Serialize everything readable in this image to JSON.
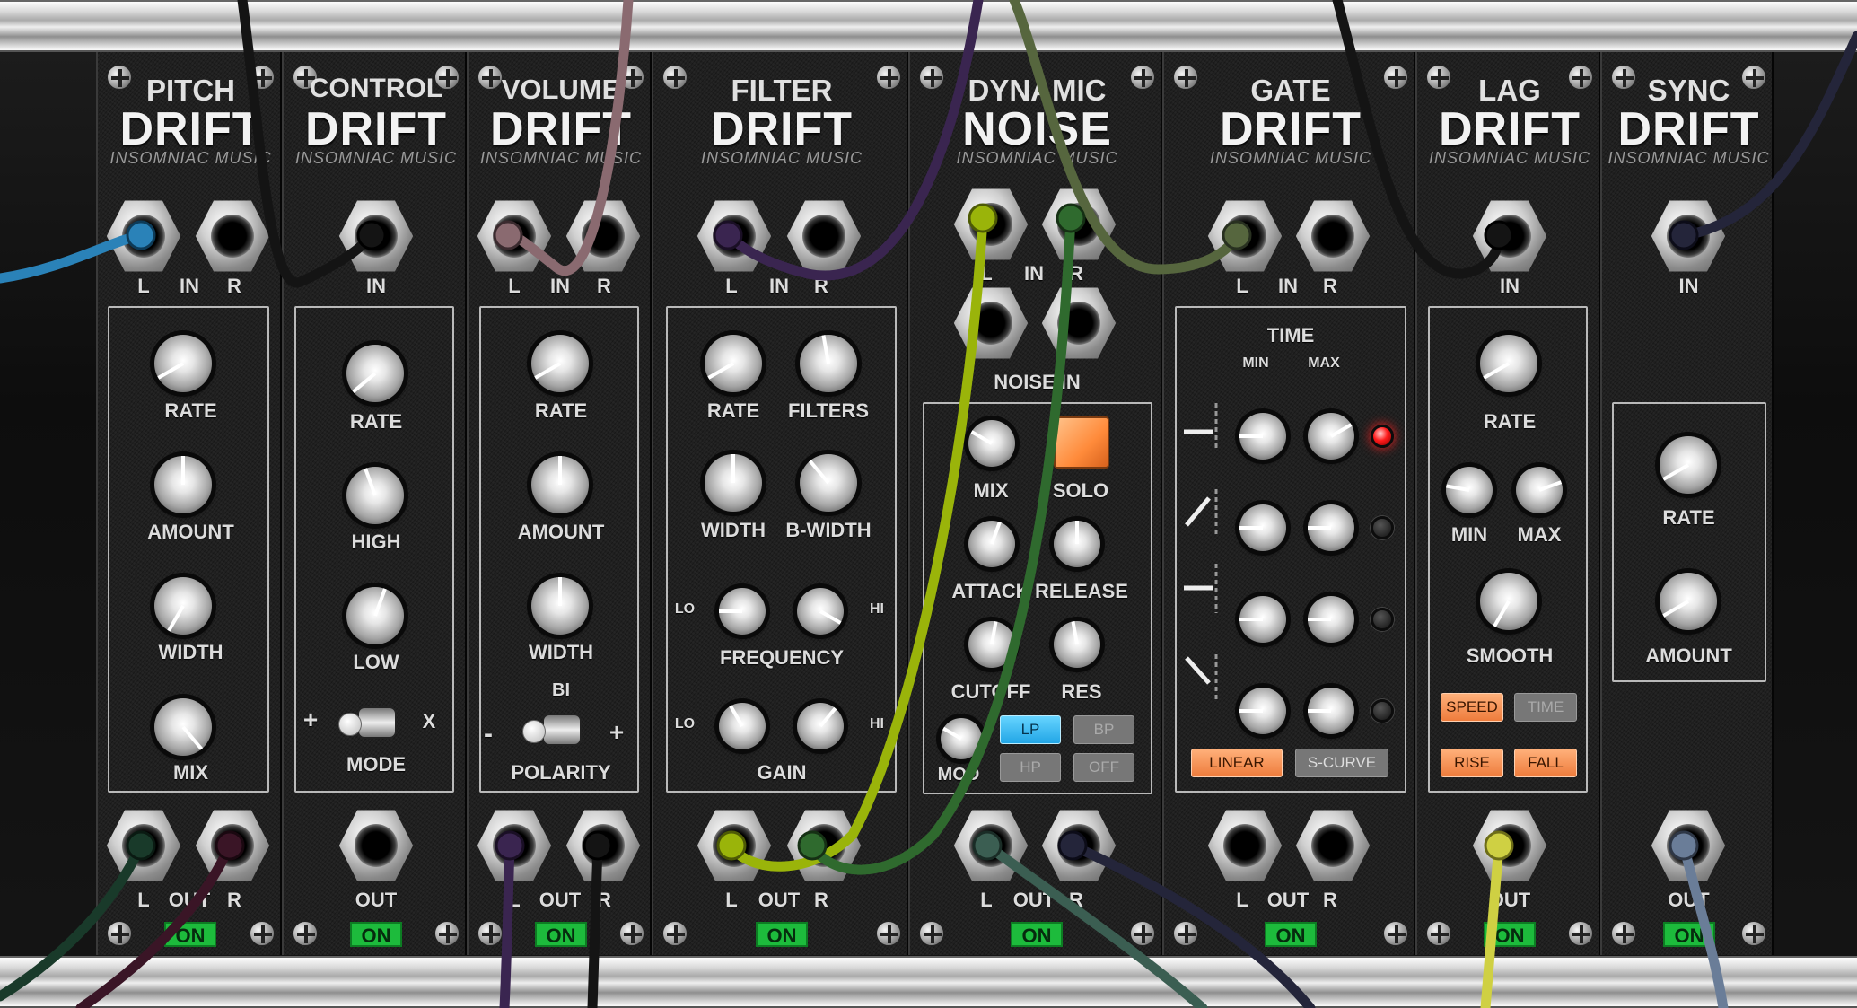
{
  "brand": "INSOMNIAC MUSIC",
  "on_label": "ON",
  "modules": {
    "pitch": {
      "title1": "PITCH",
      "title2": "DRIFT",
      "in_left": "L",
      "in_mid": "IN",
      "in_right": "R",
      "knob1": "RATE",
      "knob2": "AMOUNT",
      "knob3": "WIDTH",
      "knob4": "MIX",
      "out_left": "L",
      "out_mid": "OUT",
      "out_right": "R"
    },
    "control": {
      "title1": "CONTROL",
      "title2": "DRIFT",
      "in_label": "IN",
      "knob1": "RATE",
      "knob2": "HIGH",
      "knob3": "LOW",
      "switch_left": "+",
      "switch_right": "X",
      "switch_label": "MODE",
      "out_label": "OUT"
    },
    "volume": {
      "title1": "VOLUME",
      "title2": "DRIFT",
      "in_left": "L",
      "in_mid": "IN",
      "in_right": "R",
      "knob1": "RATE",
      "knob2": "AMOUNT",
      "knob3": "WIDTH",
      "switch_top": "BI",
      "switch_left": "-",
      "switch_right": "+",
      "switch_label": "POLARITY",
      "out_left": "L",
      "out_mid": "OUT",
      "out_right": "R"
    },
    "filter": {
      "title1": "FILTER",
      "title2": "DRIFT",
      "in_left": "L",
      "in_mid": "IN",
      "in_right": "R",
      "knob_rate": "RATE",
      "knob_filters": "FILTERS",
      "knob_width": "WIDTH",
      "knob_bwidth": "B-WIDTH",
      "freq_lo": "LO",
      "freq_hi": "HI",
      "freq_label": "FREQUENCY",
      "gain_lo": "LO",
      "gain_hi": "HI",
      "gain_label": "GAIN",
      "out_left": "L",
      "out_mid": "OUT",
      "out_right": "R"
    },
    "noise": {
      "title1": "DYNAMIC",
      "title2": "NOISE",
      "in_left": "L",
      "in_mid": "IN",
      "in_right": "R",
      "noise_in": "NOISE IN",
      "mix": "MIX",
      "solo": "SOLO",
      "attack": "ATTACK",
      "release": "RELEASE",
      "cutoff": "CUTOFF",
      "res": "RES",
      "mod": "MOD",
      "lp": "LP",
      "bp": "BP",
      "hp": "HP",
      "off": "OFF",
      "out_left": "L",
      "out_mid": "OUT",
      "out_right": "R"
    },
    "gate": {
      "title1": "GATE",
      "title2": "DRIFT",
      "in_left": "L",
      "in_mid": "IN",
      "in_right": "R",
      "time_label": "TIME",
      "min_label": "MIN",
      "max_label": "MAX",
      "linear": "LINEAR",
      "scurve": "S-CURVE",
      "out_left": "L",
      "out_mid": "OUT",
      "out_right": "R"
    },
    "lag": {
      "title1": "LAG",
      "title2": "DRIFT",
      "in_label": "IN",
      "knob_rate": "RATE",
      "knob_min": "MIN",
      "knob_max": "MAX",
      "knob_smooth": "SMOOTH",
      "speed": "SPEED",
      "time": "TIME",
      "rise": "RISE",
      "fall": "FALL",
      "out_label": "OUT"
    },
    "sync": {
      "title1": "SYNC",
      "title2": "DRIFT",
      "in_label": "IN",
      "knob_rate": "RATE",
      "knob_amount": "AMOUNT",
      "out_label": "OUT"
    }
  },
  "colors": {
    "panel": "#202020",
    "on_green": "#1dbb3c",
    "button_orange": "#ee7c3c",
    "button_blue": "#22a6e6",
    "led_red": "#ff1b1b",
    "cable_blue": "#2a82b8",
    "cable_black": "#141414",
    "cable_mauve": "#8a6a70",
    "cable_purple": "#3a2550",
    "cable_olive": "#56663e",
    "cable_yellowgreen": "#9ab40a",
    "cable_green": "#2f6a2e",
    "cable_darkgreen": "#193a2a",
    "cable_maroon": "#3a1526",
    "cable_navy": "#24253a",
    "cable_teal": "#3b5e52",
    "cable_yellow": "#cfd043",
    "cable_steel": "#6a7d98"
  }
}
